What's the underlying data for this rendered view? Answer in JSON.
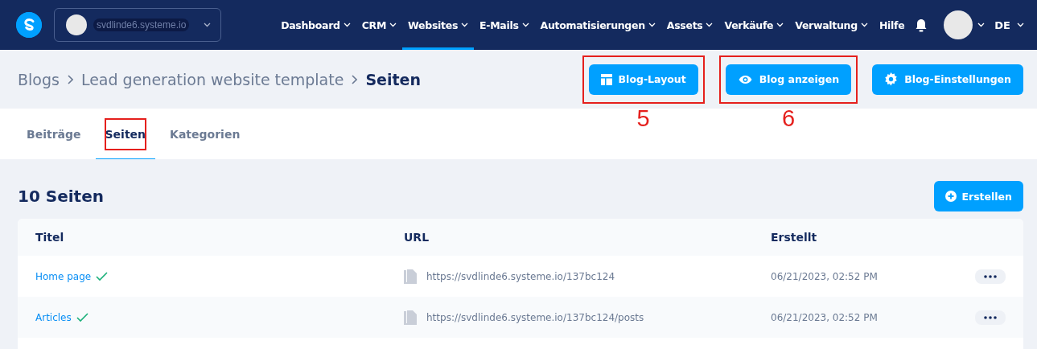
{
  "navbar": {
    "account": "svdlinde6.systeme.io",
    "menu": [
      {
        "label": "Dashboard",
        "selected": false,
        "dropdown": true
      },
      {
        "label": "CRM",
        "selected": false,
        "dropdown": true
      },
      {
        "label": "Websites",
        "selected": true,
        "dropdown": true
      },
      {
        "label": "E-Mails",
        "selected": false,
        "dropdown": true
      },
      {
        "label": "Automatisierungen",
        "selected": false,
        "dropdown": true
      },
      {
        "label": "Assets",
        "selected": false,
        "dropdown": true
      },
      {
        "label": "Verkäufe",
        "selected": false,
        "dropdown": true
      },
      {
        "label": "Verwaltung",
        "selected": false,
        "dropdown": true
      },
      {
        "label": "Hilfe",
        "selected": false,
        "dropdown": false
      }
    ],
    "language": "DE"
  },
  "breadcrumb": [
    {
      "label": "Blogs",
      "current": false
    },
    {
      "label": "Lead generation website template",
      "current": false
    },
    {
      "label": "Seiten",
      "current": true
    }
  ],
  "header_buttons": [
    {
      "label": "Blog-Layout",
      "kind": "layout",
      "annotation": "5"
    },
    {
      "label": "Blog anzeigen",
      "kind": "view",
      "annotation": "6"
    },
    {
      "label": "Blog-Einstellungen",
      "kind": "settings"
    }
  ],
  "tabs": [
    {
      "label": "Beiträge",
      "selected": false,
      "highlighted": false
    },
    {
      "label": "Seiten",
      "selected": true,
      "highlighted": true
    },
    {
      "label": "Kategorien",
      "selected": false,
      "highlighted": false
    }
  ],
  "section": {
    "title": "10 Seiten",
    "create_button": "Erstellen"
  },
  "table": {
    "columns": [
      "Titel",
      "URL",
      "Erstellt"
    ],
    "rows": [
      {
        "title": "Home page",
        "published": true,
        "url": "https://svdlinde6.systeme.io/137bc124",
        "created": "06/21/2023, 02:52 PM"
      },
      {
        "title": "Articles",
        "published": true,
        "url": "https://svdlinde6.systeme.io/137bc124/posts",
        "created": "06/21/2023, 02:52 PM"
      }
    ]
  }
}
